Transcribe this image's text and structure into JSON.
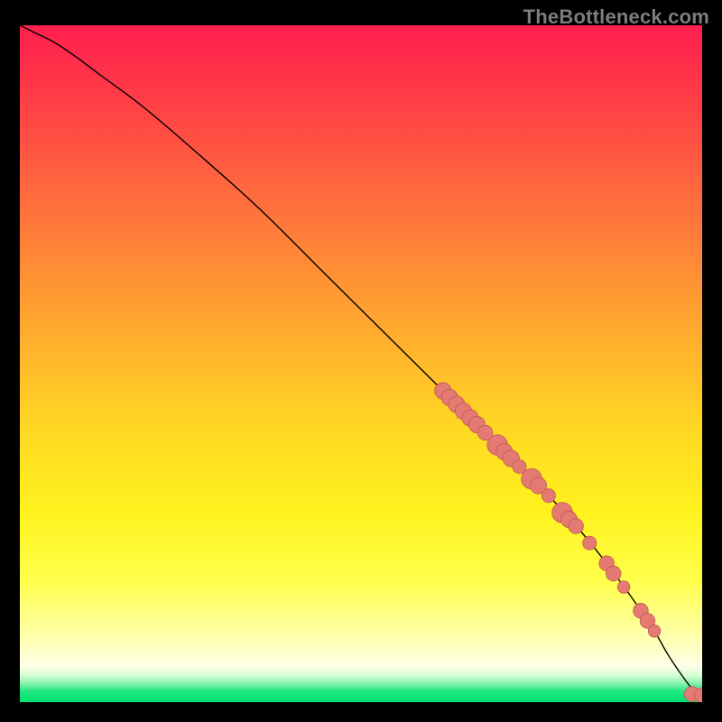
{
  "watermark": "TheBottleneck.com",
  "colors": {
    "background": "#000000",
    "curve": "#000000",
    "marker_fill": "#e47a72",
    "marker_stroke": "#bf5b54",
    "green_band": "#21e77f"
  },
  "gradient_stops": [
    {
      "offset": 0.0,
      "color": "#ff1f4e"
    },
    {
      "offset": 0.1,
      "color": "#ff3a47"
    },
    {
      "offset": 0.22,
      "color": "#ff6140"
    },
    {
      "offset": 0.35,
      "color": "#ff8a36"
    },
    {
      "offset": 0.48,
      "color": "#ffb42c"
    },
    {
      "offset": 0.6,
      "color": "#ffd923"
    },
    {
      "offset": 0.72,
      "color": "#fff21e"
    },
    {
      "offset": 0.82,
      "color": "#ffff4a"
    },
    {
      "offset": 0.9,
      "color": "#ffffa8"
    },
    {
      "offset": 0.945,
      "color": "#feffe6"
    },
    {
      "offset": 0.96,
      "color": "#d8ffd8"
    },
    {
      "offset": 0.972,
      "color": "#8af2af"
    },
    {
      "offset": 0.984,
      "color": "#21e77f"
    },
    {
      "offset": 1.0,
      "color": "#00e173"
    }
  ],
  "chart_data": {
    "type": "line",
    "title": "",
    "xlabel": "",
    "ylabel": "",
    "xlim": [
      0,
      100
    ],
    "ylim": [
      0,
      100
    ],
    "grid": false,
    "legend": false,
    "series": [
      {
        "name": "bottleneck-curve",
        "x": [
          0,
          2,
          5,
          8,
          12,
          18,
          25,
          35,
          45,
          55,
          62,
          66,
          70,
          74,
          78,
          82,
          86,
          90,
          93,
          95,
          97,
          98.5,
          99.5,
          100
        ],
        "y": [
          100,
          99,
          97.5,
          95.5,
          92.5,
          88,
          82,
          73,
          63,
          53,
          46,
          42,
          38,
          34,
          30,
          25.5,
          20.5,
          15,
          10.5,
          7,
          4,
          2,
          1,
          1
        ]
      }
    ],
    "markers": [
      {
        "x": 62.0,
        "y": 46.0,
        "r": 1.2
      },
      {
        "x": 63.0,
        "y": 45.0,
        "r": 1.2
      },
      {
        "x": 64.0,
        "y": 44.0,
        "r": 1.2
      },
      {
        "x": 65.0,
        "y": 43.0,
        "r": 1.2
      },
      {
        "x": 66.0,
        "y": 42.0,
        "r": 1.2
      },
      {
        "x": 67.0,
        "y": 41.0,
        "r": 1.2
      },
      {
        "x": 68.2,
        "y": 39.8,
        "r": 1.1
      },
      {
        "x": 70.0,
        "y": 38.0,
        "r": 1.5
      },
      {
        "x": 71.0,
        "y": 37.0,
        "r": 1.2
      },
      {
        "x": 72.0,
        "y": 36.0,
        "r": 1.2
      },
      {
        "x": 73.2,
        "y": 34.8,
        "r": 1.0
      },
      {
        "x": 75.0,
        "y": 33.0,
        "r": 1.5
      },
      {
        "x": 76.0,
        "y": 32.0,
        "r": 1.2
      },
      {
        "x": 77.5,
        "y": 30.5,
        "r": 1.0
      },
      {
        "x": 79.5,
        "y": 28.0,
        "r": 1.5
      },
      {
        "x": 80.5,
        "y": 27.0,
        "r": 1.2
      },
      {
        "x": 81.5,
        "y": 26.0,
        "r": 1.1
      },
      {
        "x": 83.5,
        "y": 23.5,
        "r": 1.0
      },
      {
        "x": 86.0,
        "y": 20.5,
        "r": 1.1
      },
      {
        "x": 87.0,
        "y": 19.0,
        "r": 1.1
      },
      {
        "x": 88.5,
        "y": 17.0,
        "r": 0.9
      },
      {
        "x": 91.0,
        "y": 13.5,
        "r": 1.1
      },
      {
        "x": 92.0,
        "y": 12.0,
        "r": 1.1
      },
      {
        "x": 93.0,
        "y": 10.5,
        "r": 0.9
      },
      {
        "x": 98.5,
        "y": 1.2,
        "r": 1.1
      },
      {
        "x": 100.0,
        "y": 1.0,
        "r": 1.1
      }
    ]
  }
}
